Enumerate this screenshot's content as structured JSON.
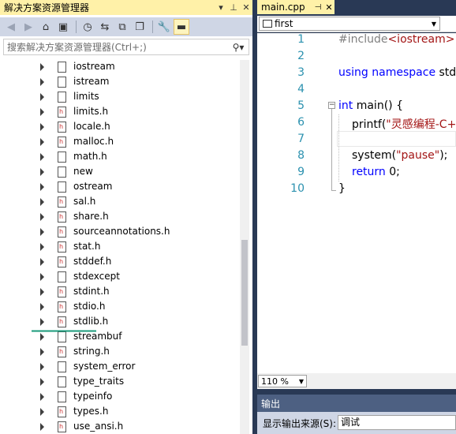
{
  "solution_explorer": {
    "title": "解决方案资源管理器",
    "search_placeholder": "搜索解决方案资源管理器(Ctrl+;)",
    "tree_items": [
      {
        "label": "iostream",
        "type": "file"
      },
      {
        "label": "istream",
        "type": "file"
      },
      {
        "label": "limits",
        "type": "file"
      },
      {
        "label": "limits.h",
        "type": "header"
      },
      {
        "label": "locale.h",
        "type": "header"
      },
      {
        "label": "malloc.h",
        "type": "header"
      },
      {
        "label": "math.h",
        "type": "file"
      },
      {
        "label": "new",
        "type": "file"
      },
      {
        "label": "ostream",
        "type": "file"
      },
      {
        "label": "sal.h",
        "type": "header"
      },
      {
        "label": "share.h",
        "type": "header"
      },
      {
        "label": "sourceannotations.h",
        "type": "header"
      },
      {
        "label": "stat.h",
        "type": "header"
      },
      {
        "label": "stddef.h",
        "type": "header"
      },
      {
        "label": "stdexcept",
        "type": "file"
      },
      {
        "label": "stdint.h",
        "type": "header"
      },
      {
        "label": "stdio.h",
        "type": "header"
      },
      {
        "label": "stdlib.h",
        "type": "header"
      },
      {
        "label": "streambuf",
        "type": "file"
      },
      {
        "label": "string.h",
        "type": "header"
      },
      {
        "label": "system_error",
        "type": "file"
      },
      {
        "label": "type_traits",
        "type": "file"
      },
      {
        "label": "typeinfo",
        "type": "file"
      },
      {
        "label": "types.h",
        "type": "header"
      },
      {
        "label": "use_ansi.h",
        "type": "header"
      }
    ],
    "annotation_color": "#1a9a7a"
  },
  "editor": {
    "tab_label": "main.cpp",
    "scope_combo": "first",
    "line_numbers": [
      "1",
      "2",
      "3",
      "4",
      "5",
      "6",
      "7",
      "8",
      "9",
      "10"
    ],
    "code": {
      "l1_directive": "#include",
      "l1_header": "<iostream>",
      "l3_kw1": "using",
      "l3_kw2": "namespace",
      "l3_rest": " std;",
      "l5_kw": "int",
      "l5_rest": " main() {",
      "l6_fn": "printf(",
      "l6_str": "\"灵感编程-C+",
      "l8_fn": "system(",
      "l8_str": "\"pause\"",
      "l8_rest": ");",
      "l9_kw": "return",
      "l9_rest": " 0;",
      "l10": "}"
    },
    "zoom": "110 %",
    "fold_minus": "−"
  },
  "output": {
    "title": "输出",
    "source_label": "显示输出来源(S):",
    "source_value": "调试"
  },
  "colors": {
    "active_title": "#fff1a8",
    "chrome_blue": "#293955",
    "keyword": "#0000ff",
    "string": "#a31515",
    "line_number": "#2b91af"
  }
}
